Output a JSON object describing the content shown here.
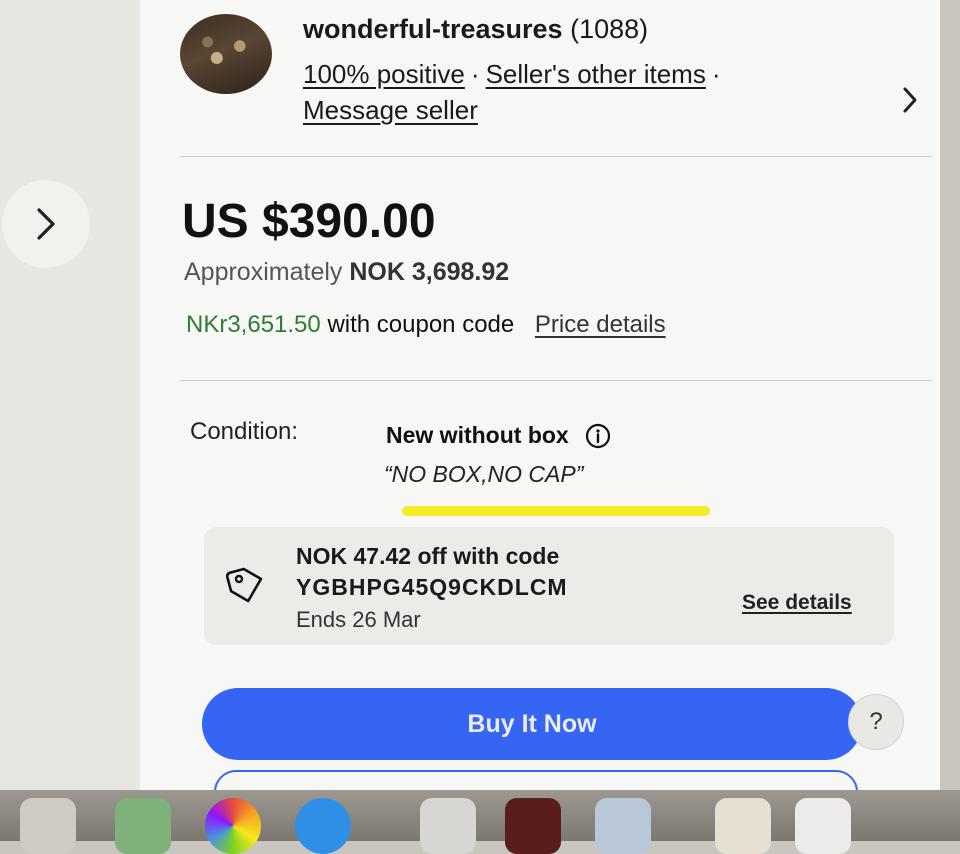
{
  "seller": {
    "name": "wonderful-treasures",
    "feedback_count": "(1088)",
    "positive_link": "100% positive",
    "separator": "·",
    "other_items_link": "Seller's other items",
    "message_link": "Message seller"
  },
  "price": {
    "main": "US $390.00",
    "approx_label": "Approximately",
    "approx_value": "NOK 3,698.92",
    "coupon_price": "NKr3,651.50",
    "coupon_suffix": "with coupon code",
    "details_link": "Price details"
  },
  "condition": {
    "label": "Condition:",
    "value": "New without box",
    "note": "“NO BOX,NO CAP”"
  },
  "coupon": {
    "line1": "NOK 47.42 off with code",
    "code": "YGBHPG45Q9CKDLCM",
    "ends": "Ends 26 Mar",
    "see_details": "See details"
  },
  "actions": {
    "buy_now": "Buy It Now",
    "help": "?"
  },
  "icons": {
    "gallery_next": "chevron-right-icon",
    "seller_chevron": "chevron-right-icon",
    "condition_info": "info-icon",
    "coupon": "tag-icon"
  },
  "colors": {
    "buy_now": "#3665f3",
    "coupon_price": "#2e7d32",
    "highlight": "#f4ec2a"
  }
}
